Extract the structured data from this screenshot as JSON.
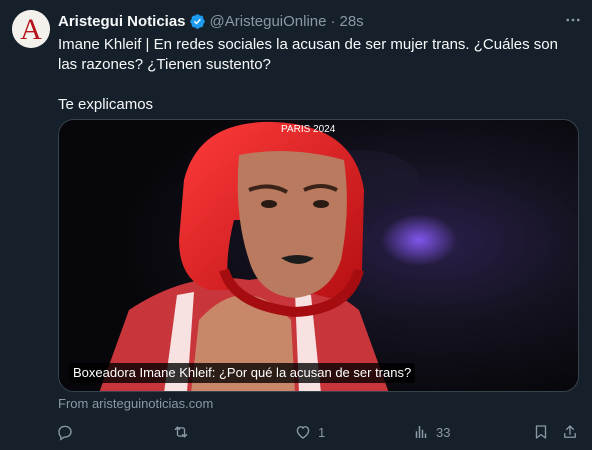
{
  "tweet": {
    "display_name": "Aristegui Noticias",
    "handle": "@AristeguiOnline",
    "separator": "·",
    "timestamp": "28s",
    "verified": true,
    "avatar_letter": "A",
    "text_line1": "Imane Khleif | En redes sociales la acusan de ser mujer trans. ¿Cuáles son las razones? ¿Tienen sustento?",
    "text_line2": "Te explicamos",
    "card": {
      "caption": "Boxeadora Imane Khleif: ¿Por qué la acusan de ser trans?",
      "source": "From aristeguinoticias.com",
      "photo_text": "PARIS 2024"
    },
    "actions": {
      "reply_count": "",
      "retweet_count": "",
      "like_count": "1",
      "views_count": "33"
    }
  },
  "icons": {
    "more": "more-horizontal-icon",
    "verified": "verified-badge-icon",
    "reply": "reply-icon",
    "retweet": "retweet-icon",
    "like": "heart-icon",
    "views": "views-icon",
    "bookmark": "bookmark-icon",
    "share": "share-icon"
  },
  "colors": {
    "background": "#15202b",
    "text": "#f7f9f9",
    "muted": "#8b98a5",
    "verified": "#1d9bf0",
    "brand_red": "#b5121b"
  }
}
